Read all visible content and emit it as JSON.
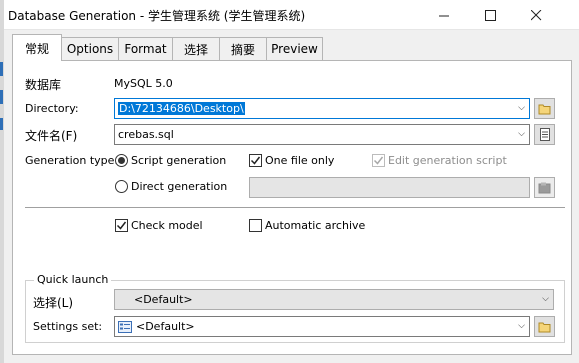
{
  "window": {
    "title": "Database Generation - 学生管理系统 (学生管理系统)",
    "minimize_icon": "minimize-icon",
    "maximize_icon": "maximize-icon",
    "close_icon": "close-icon"
  },
  "tabs": [
    {
      "label": "常规",
      "active": true
    },
    {
      "label": "Options"
    },
    {
      "label": "Format"
    },
    {
      "label": "选择"
    },
    {
      "label": "摘要"
    },
    {
      "label": "Preview"
    }
  ],
  "general": {
    "dbms_label": "数据库",
    "dbms_value": "MySQL 5.0",
    "directory_label": "Directory:",
    "directory_value": "D:\\72134686\\Desktop\\",
    "filename_label": "文件名(F)",
    "filename_value": "crebas.sql",
    "generation_type_label": "Generation type:",
    "script_generation": {
      "label": "Script generation",
      "selected": true
    },
    "direct_generation": {
      "label": "Direct generation",
      "selected": false
    },
    "one_file_only": {
      "label": "One file only",
      "checked": true
    },
    "edit_generation_script": {
      "label": "Edit generation script",
      "checked": true,
      "enabled": false
    },
    "data_source_value": "",
    "check_model": {
      "label": "Check model",
      "checked": true
    },
    "automatic_archive": {
      "label": "Automatic archive",
      "checked": false
    }
  },
  "quick_launch": {
    "title": "Quick launch",
    "selection_label": "选择(L)",
    "selection_value": "<Default>",
    "settings_label": "Settings set:",
    "settings_value": "<Default>"
  },
  "colors": {
    "accent": "#0078d7",
    "window_bg": "#f0f0f0",
    "panel_bg": "#ffffff"
  }
}
